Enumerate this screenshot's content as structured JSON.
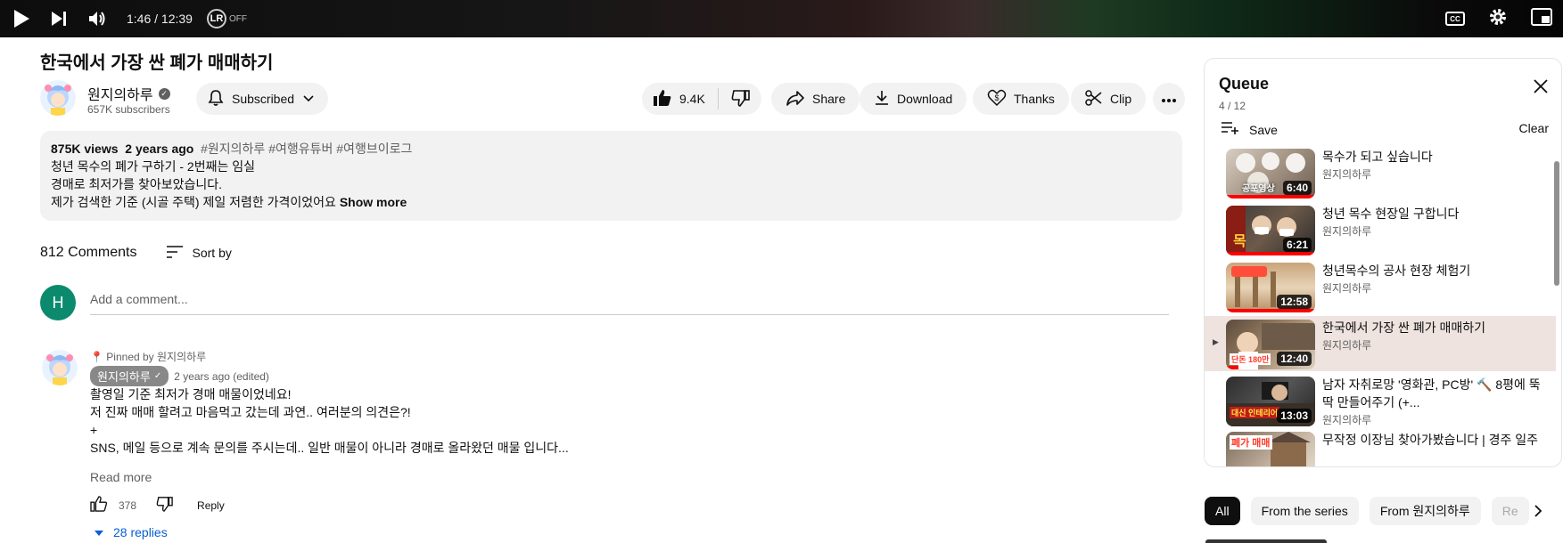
{
  "player": {
    "time": "1:46 / 12:39",
    "lr_label": "LR",
    "lr_state": "OFF",
    "icons": [
      "play-icon",
      "next-icon",
      "volume-icon",
      "cc-icon",
      "settings-icon",
      "miniplayer-icon"
    ],
    "cc_label": "CC"
  },
  "video": {
    "title": "한국에서 가장 싼 폐가 매매하기",
    "channel": "원지의하루",
    "subscribers": "657K subscribers",
    "subscribed_label": "Subscribed",
    "likes": "9.4K",
    "share_label": "Share",
    "download_label": "Download",
    "thanks_label": "Thanks",
    "clip_label": "Clip"
  },
  "description": {
    "views": "875K views",
    "age": "2 years ago",
    "tags": "#원지의하루 #여행유튜버 #여행브이로그",
    "line1": "청년 목수의 폐가 구하기 - 2번째는 임실",
    "line2": "경매로 최저가를 찾아보았습니다.",
    "line3": "제가 검색한 기준 (시골 주택) 제일 저렴한 가격이었어요",
    "show_more": "Show more"
  },
  "comments": {
    "count_label": "812 Comments",
    "sort_label": "Sort by",
    "user_initial": "H",
    "add_placeholder": "Add a comment...",
    "pinned": {
      "pinned_label": "Pinned by 원지의하루",
      "author": "원지의하루",
      "meta": "2 years ago (edited)",
      "lines": [
        "촬영일 기준 최저가 경매 매물이었네요!",
        "저 진짜 매매 할려고 마음먹고 갔는데 과연.. 여러분의 의견은?!",
        "+",
        "SNS, 메일 등으로 계속 문의를 주시는데.. 일반 매물이 아니라 경매로 올라왔던 매물 입니다..."
      ],
      "read_more": "Read more",
      "likes": "378",
      "reply_label": "Reply",
      "replies_label": "28 replies"
    }
  },
  "queue": {
    "title": "Queue",
    "position": "4 / 12",
    "save_label": "Save",
    "clear_label": "Clear",
    "items": [
      {
        "title": "목수가 되고 싶습니다",
        "channel": "원지의하루",
        "duration": "6:40",
        "thumb_text": "공포영상",
        "progress": 1.0
      },
      {
        "title": "청년 목수 현장일 구합니다",
        "channel": "원지의하루",
        "duration": "6:21",
        "thumb_text": "목",
        "progress": 1.0
      },
      {
        "title": "청년목수의 공사 현장 체험기",
        "channel": "원지의하루",
        "duration": "12:58",
        "thumb_text": "",
        "progress": 1.0
      },
      {
        "title": "한국에서 가장 싼 폐가 매매하기",
        "channel": "원지의하루",
        "duration": "12:40",
        "thumb_text": "단돈 180만",
        "progress": 0.14,
        "active": true
      },
      {
        "title": "남자 자취로망 '영화관, PC방' 🔨 8평에 뚝딱 만들어주기 (+...",
        "channel": "원지의하루",
        "duration": "13:03",
        "thumb_text": "대신 인테리어",
        "progress": 0
      },
      {
        "title": "무작정 이장님 찾아가봤습니다 | 경주 일주",
        "channel": "원지의하루",
        "duration": "",
        "thumb_text": "폐가 매매",
        "progress": 0
      }
    ]
  },
  "filter_chips": [
    "All",
    "From the series",
    "From 원지의하루",
    "Re"
  ],
  "colors": {
    "accent_blue": "#065fd4",
    "progress_red": "#ff0000",
    "chip_bg": "#f2f2f2",
    "active_row": "#eee3df"
  }
}
